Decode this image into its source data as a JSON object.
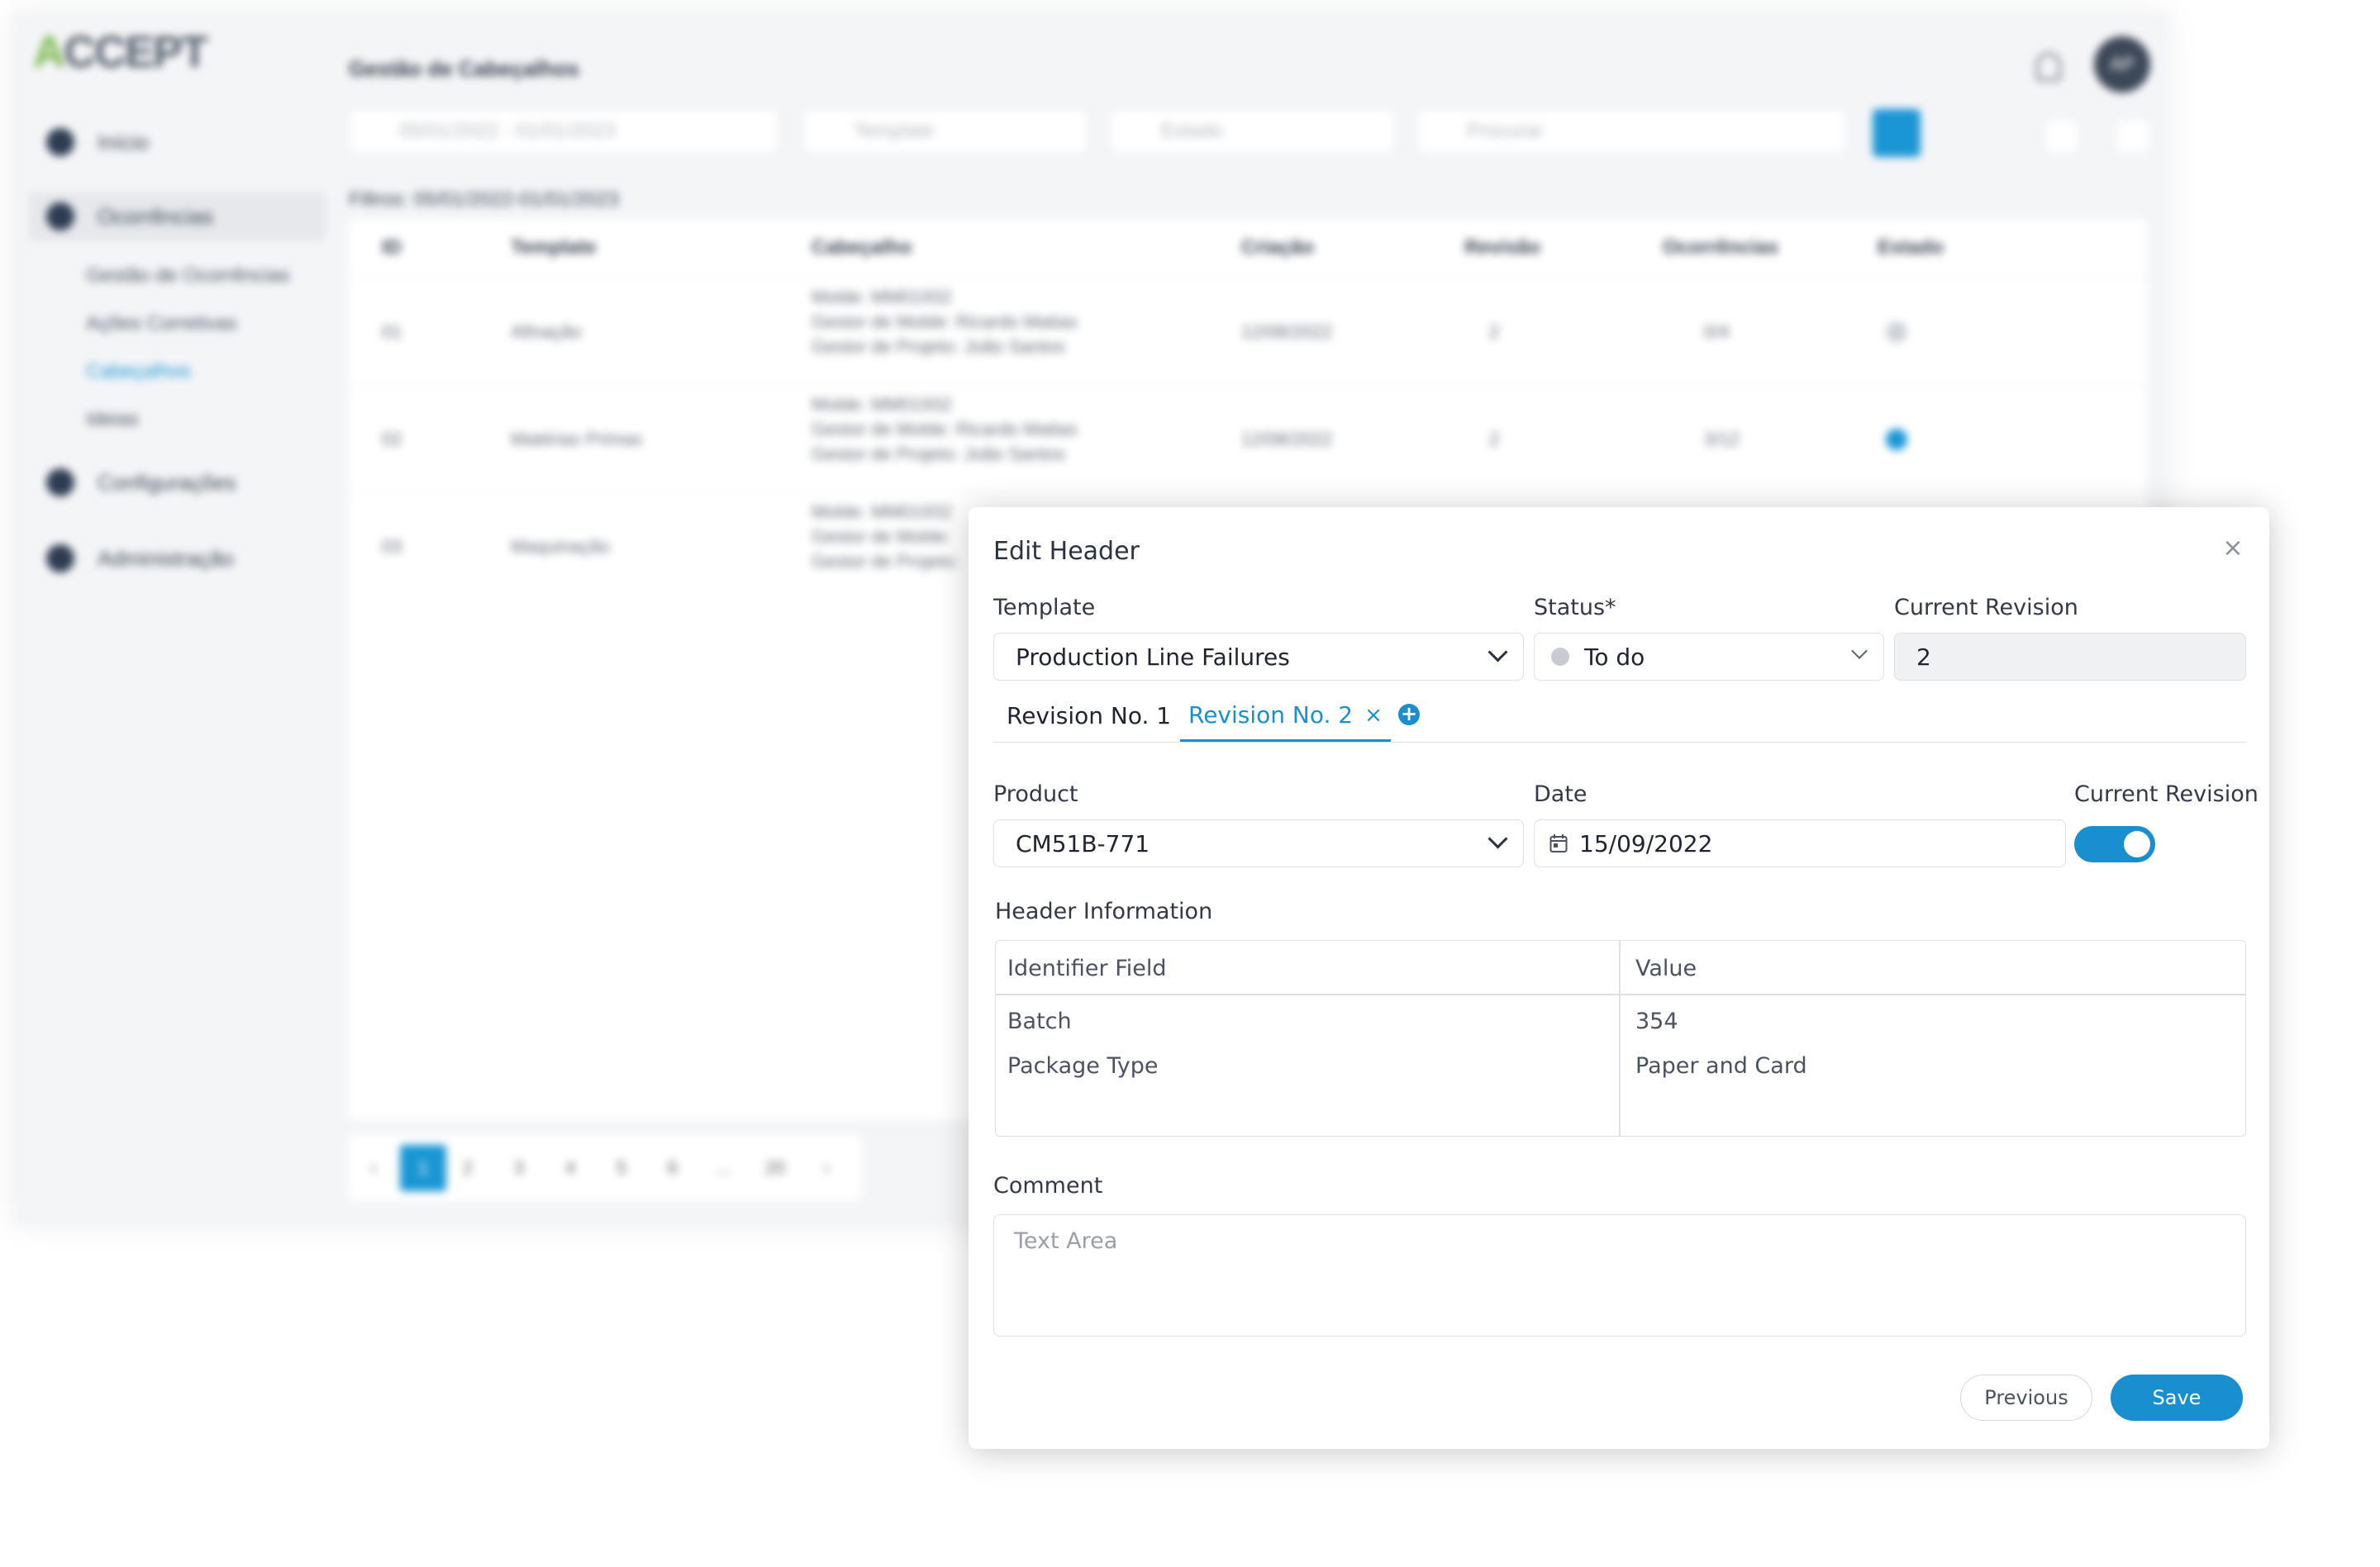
{
  "background": {
    "logo": "ACCEPT",
    "page_title": "Gestão de Cabeçalhos",
    "nav": [
      {
        "label": "Início",
        "icon": "home-icon"
      },
      {
        "label": "Ocorrências",
        "icon": "alert-icon"
      },
      {
        "label": "Configurações",
        "icon": "gear-icon"
      },
      {
        "label": "Administração",
        "icon": "admin-icon"
      }
    ],
    "subnav": [
      "Gestão de Ocorrências",
      "Ações Corretivas",
      "Cabeçalhos",
      "Ideias"
    ],
    "filters": {
      "date_range": "05/01/2022 - 01/01/2023",
      "template_placeholder": "Template",
      "status_placeholder": "Estado",
      "search_placeholder": "Procurar",
      "applied": "Filtros: 05/01/2022-01/01/2023"
    },
    "avatar_initials": "AP",
    "table": {
      "columns": [
        "ID",
        "Template",
        "Cabeçalho",
        "Criação",
        "Revisão",
        "Ocorrências",
        "Estado"
      ],
      "rows": [
        {
          "id": "01",
          "template": "Afinação",
          "header": [
            "Molde: MM01932",
            "Gestor de Molde: Ricardo Matias",
            "Gestor de Projeto: João Santos"
          ],
          "created": "12/08/2022",
          "revision": "2",
          "occurrences": "0/4",
          "status_color": "#cfd3d8"
        },
        {
          "id": "02",
          "template": "Matérias Primas",
          "header": [
            "Molde: MM01932",
            "Gestor de Molde: Ricardo Matias",
            "Gestor de Projeto: João Santos"
          ],
          "created": "12/08/2022",
          "revision": "2",
          "occurrences": "3/12",
          "status_color": "#1a96d4"
        },
        {
          "id": "03",
          "template": "Maquinação",
          "header": [
            "Molde: MM01932",
            "Gestor de Molde:",
            "Gestor de Projeto:"
          ],
          "created": "",
          "revision": "",
          "occurrences": "",
          "status_color": ""
        }
      ]
    },
    "pagination": [
      "‹",
      "1",
      "2",
      "3",
      "4",
      "5",
      "6",
      "...",
      "20",
      "›"
    ]
  },
  "modal": {
    "title": "Edit Header",
    "close_symbol": "×",
    "template": {
      "label": "Template",
      "value": "Production Line Failures"
    },
    "status": {
      "label": "Status*",
      "value": "To do",
      "dot_color": "#c8ccd2"
    },
    "current_revision": {
      "label": "Current Revision",
      "value": "2"
    },
    "tabs": [
      {
        "label": "Revision No. 1",
        "active": false
      },
      {
        "label": "Revision No. 2",
        "active": true,
        "close": "×"
      }
    ],
    "add_tab_symbol": "+",
    "product": {
      "label": "Product",
      "value": "CM51B-771"
    },
    "date": {
      "label": "Date",
      "value": "15/09/2022"
    },
    "current_revision_toggle": {
      "label": "Current Revision",
      "on": true
    },
    "header_info": {
      "label": "Header Information",
      "columns": [
        "Identifier Field",
        "Value"
      ],
      "rows": [
        {
          "field": "Batch",
          "value": "354"
        },
        {
          "field": "Package Type",
          "value": "Paper and Card"
        }
      ]
    },
    "comment": {
      "label": "Comment",
      "placeholder": "Text Area"
    },
    "buttons": {
      "previous": "Previous",
      "save": "Save"
    }
  }
}
